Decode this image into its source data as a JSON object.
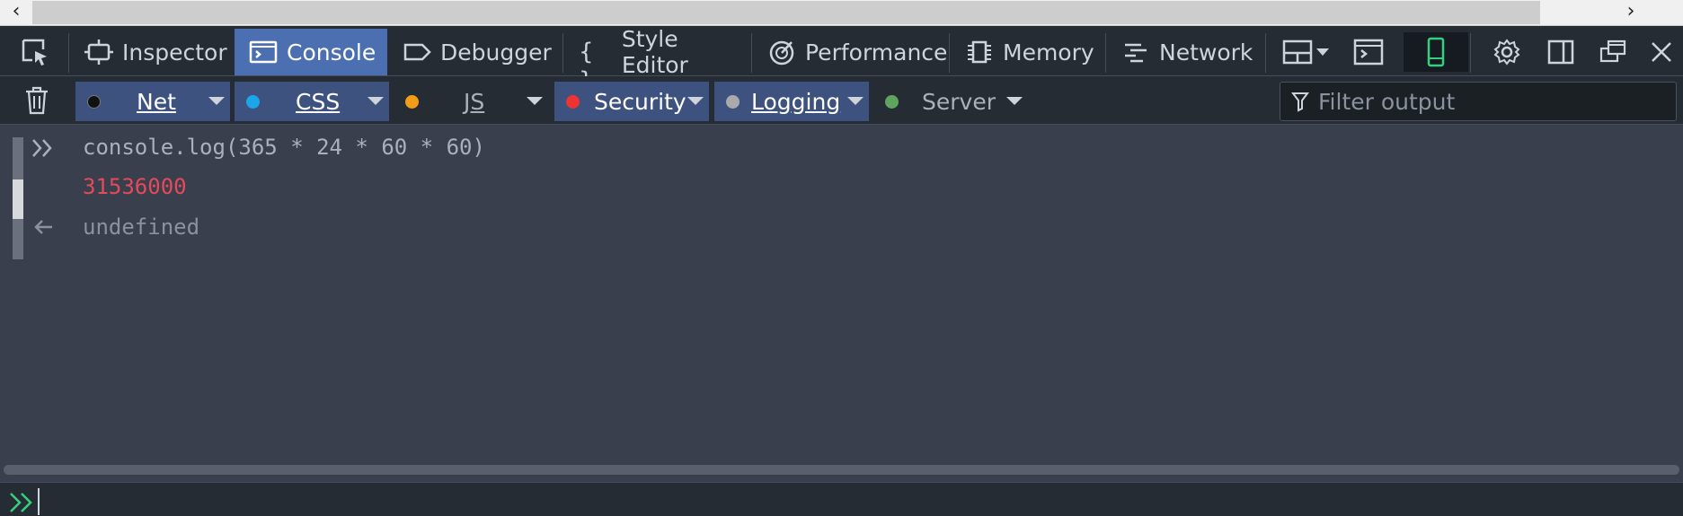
{
  "scrollbar": {
    "left_arrow": "‹",
    "right_arrow": "›"
  },
  "tabs": [
    {
      "label": "Inspector",
      "icon": "inspector-icon"
    },
    {
      "label": "Console",
      "icon": "console-icon",
      "selected": true
    },
    {
      "label": "Debugger",
      "icon": "debugger-icon"
    },
    {
      "label": "Style Editor",
      "icon": "style-editor-icon"
    },
    {
      "label": "Performance",
      "icon": "performance-icon"
    },
    {
      "label": "Memory",
      "icon": "memory-icon"
    },
    {
      "label": "Network",
      "icon": "network-icon"
    }
  ],
  "filters": [
    {
      "label": "Net",
      "dot_color": "#111111",
      "active": true
    },
    {
      "label": "CSS",
      "dot_color": "#1aa6e8",
      "active": true
    },
    {
      "label": "JS",
      "dot_color": "#f39c17",
      "active": false
    },
    {
      "label": "Security",
      "dot_color": "#ee3333",
      "active": true
    },
    {
      "label": "Logging",
      "dot_color": "#aaaaaa",
      "active": true
    },
    {
      "label": "Server",
      "dot_color": "#5ea55e",
      "active": false
    }
  ],
  "filter_input": {
    "placeholder": "Filter output"
  },
  "console": {
    "input": "console.log(365 * 24 * 60 * 60)",
    "log_output": "31536000",
    "result": "undefined"
  },
  "colors": {
    "accent": "#4c6fb1",
    "prompt_green": "#35d07f",
    "log_red": "#e34a5c"
  }
}
